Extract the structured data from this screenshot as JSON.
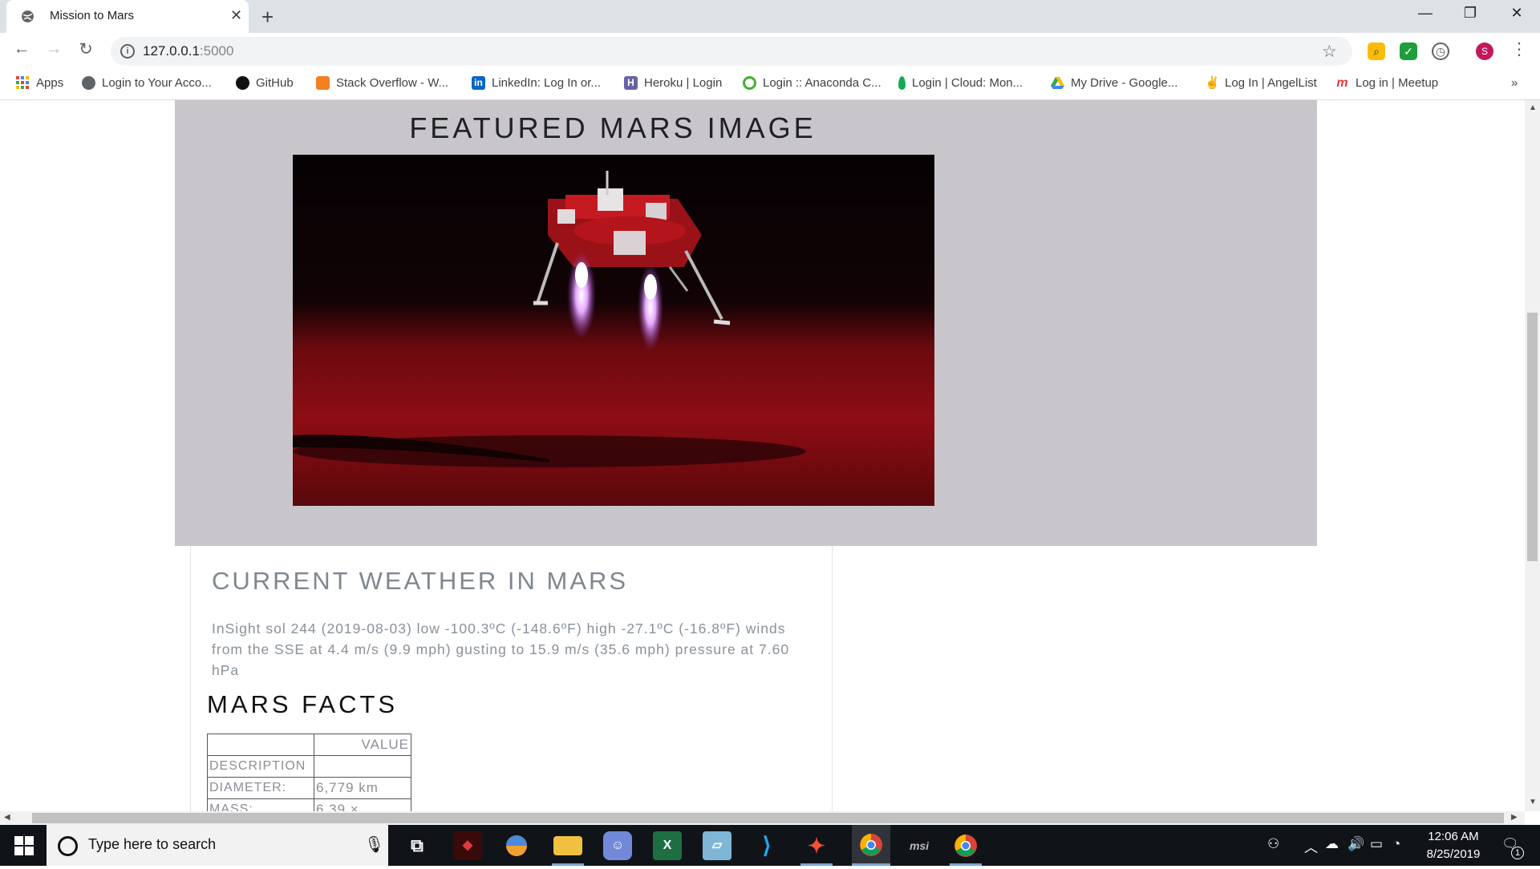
{
  "browser": {
    "tab_title": "Mission to Mars",
    "url_host": "127.0.0.1",
    "url_port": ":5000",
    "profile_initial": "S",
    "bookmarks": [
      {
        "label": "Apps",
        "icon": "apps-grid-icon",
        "color": "#4285f4"
      },
      {
        "label": "Login to Your Acco...",
        "icon": "globe-icon",
        "color": "#5f6368"
      },
      {
        "label": "GitHub",
        "icon": "github-icon",
        "color": "#111111"
      },
      {
        "label": "Stack Overflow - W...",
        "icon": "stackoverflow-icon",
        "color": "#f48024"
      },
      {
        "label": "LinkedIn: Log In or...",
        "icon": "linkedin-icon",
        "color": "#0a66c2"
      },
      {
        "label": "Heroku | Login",
        "icon": "heroku-icon",
        "color": "#6762a6"
      },
      {
        "label": "Login :: Anaconda C...",
        "icon": "anaconda-icon",
        "color": "#43b02a"
      },
      {
        "label": "Login | Cloud: Mon...",
        "icon": "mongodb-leaf-icon",
        "color": "#13aa52"
      },
      {
        "label": "My Drive - Google...",
        "icon": "google-drive-icon",
        "color": "#fbbc04"
      },
      {
        "label": "Log In | AngelList",
        "icon": "angellist-icon",
        "color": "#111111"
      },
      {
        "label": "Log in | Meetup",
        "icon": "meetup-icon",
        "color": "#e0393e"
      }
    ],
    "more_bookmarks": "»"
  },
  "page": {
    "featured_title": "FEATURED MARS IMAGE",
    "weather_title": "CURRENT WEATHER IN MARS",
    "weather_text": "InSight sol 244 (2019-08-03) low -100.3ºC (-148.6ºF) high -27.1ºC (-16.8ºF) winds from the SSE at 4.4 m/s (9.9 mph) gusting to 15.9 m/s (35.6 mph) pressure at 7.60 hPa",
    "facts_title": "MARS FACTS",
    "facts_table": {
      "header": [
        "",
        "VALUE"
      ],
      "rows": [
        [
          "DESCRIPTION",
          ""
        ],
        [
          "DIAMETER:",
          "6,779 km"
        ],
        [
          "MASS:",
          "6.39 ×"
        ]
      ]
    }
  },
  "taskbar": {
    "search_placeholder": "Type here to search",
    "time": "12:06 AM",
    "date": "8/25/2019",
    "notification_count": "1",
    "apps": [
      "task-view-icon",
      "game-app-icon",
      "browser-app-icon",
      "file-explorer-icon",
      "discord-icon",
      "excel-icon",
      "notes-app-icon",
      "vscode-icon",
      "git-app-icon",
      "chrome-icon",
      "msi-icon",
      "chrome-icon"
    ]
  }
}
